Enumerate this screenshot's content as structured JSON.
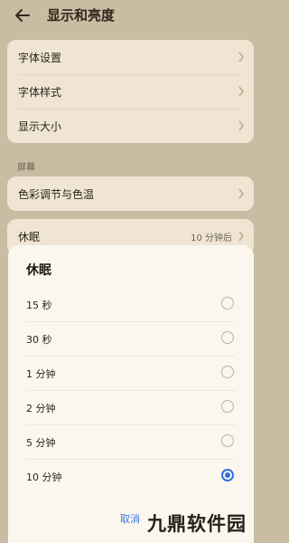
{
  "header": {
    "title": "显示和亮度",
    "back_icon": "arrow-left-icon"
  },
  "font_card": {
    "items": [
      {
        "label": "字体设置"
      },
      {
        "label": "字体样式"
      },
      {
        "label": "显示大小"
      }
    ]
  },
  "screen_section": {
    "label": "屏幕",
    "items": [
      {
        "label": "色彩调节与色温"
      }
    ]
  },
  "sleep_row": {
    "label": "休眠",
    "value": "10 分钟后"
  },
  "dialog": {
    "title": "休眠",
    "options": [
      {
        "label": "15 秒",
        "selected": false
      },
      {
        "label": "30 秒",
        "selected": false
      },
      {
        "label": "1 分钟",
        "selected": false
      },
      {
        "label": "2 分钟",
        "selected": false
      },
      {
        "label": "5 分钟",
        "selected": false
      },
      {
        "label": "10 分钟",
        "selected": true
      }
    ],
    "cancel_label": "取消"
  },
  "watermark": "九鼎软件园",
  "colors": {
    "background": "#c9bca2",
    "card": "#efe5d2",
    "sheet": "#fbf7ef",
    "accent": "#2f6fe3"
  }
}
